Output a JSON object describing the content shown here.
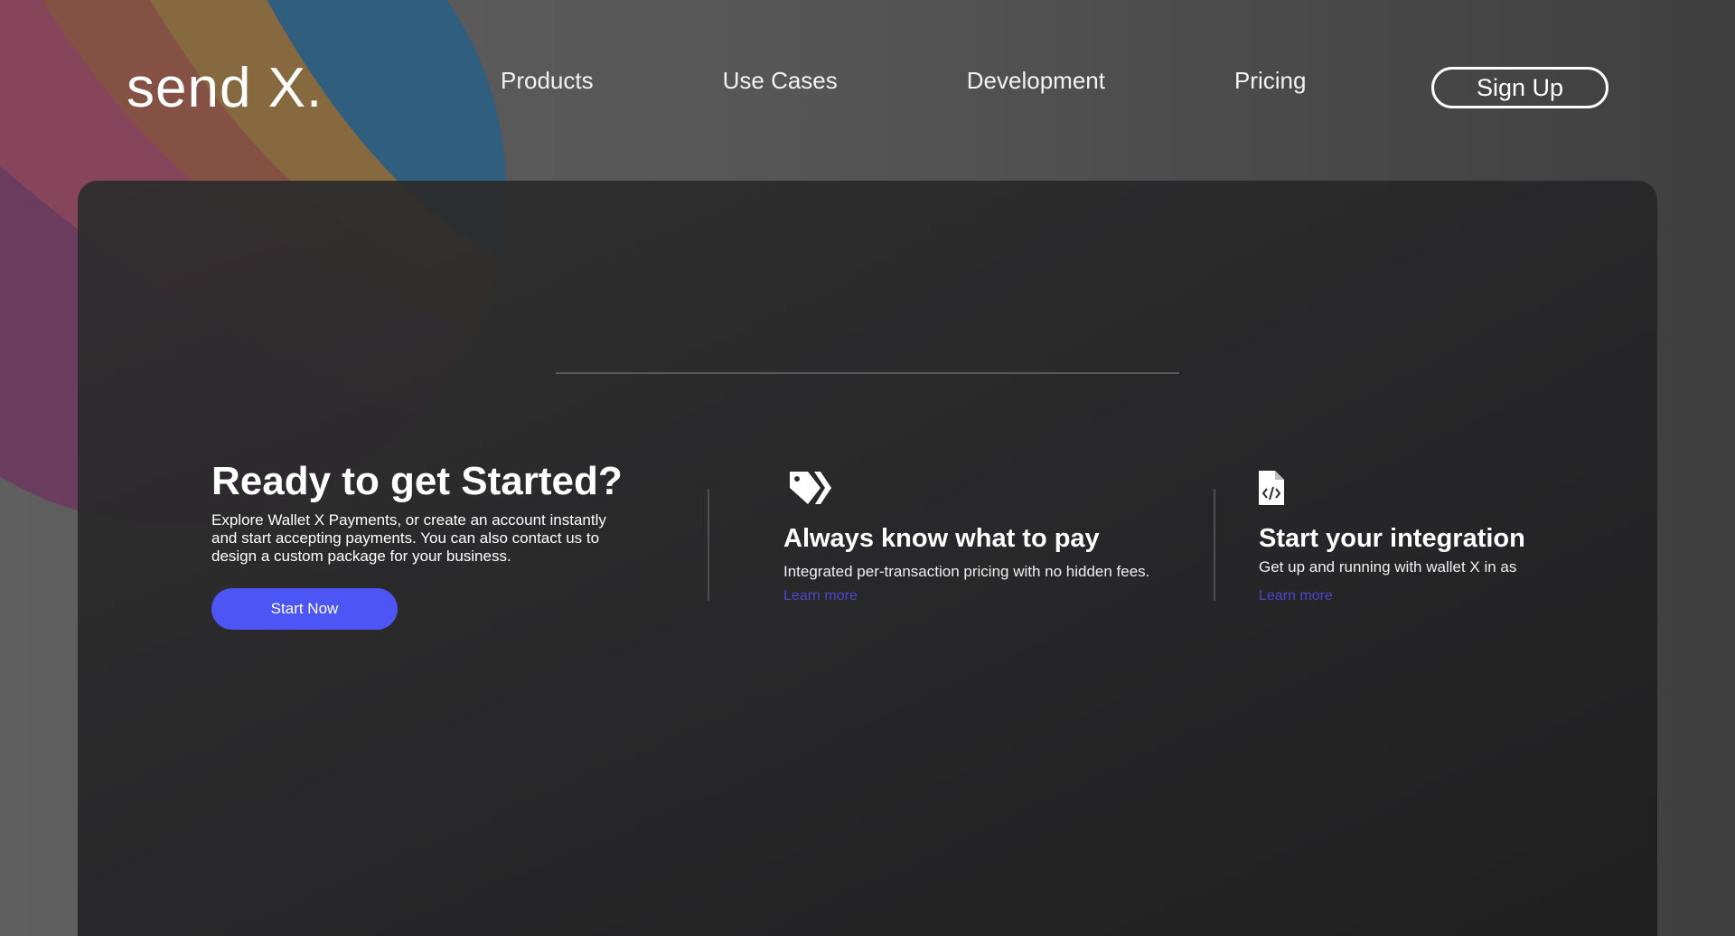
{
  "header": {
    "logo": "send X.",
    "nav": [
      "Products",
      "Use Cases",
      "Development",
      "Pricing"
    ],
    "signup_label": "Sign Up"
  },
  "cta": {
    "title": "Ready to get Started?",
    "text": "Explore Wallet X Payments, or create an account instantly and start accepting payments. You can also contact us to design a custom package for your business.",
    "button_label": "Start Now"
  },
  "features": [
    {
      "icon": "tags-icon",
      "title": "Always know what to pay",
      "text": "Integrated per-transaction pricing with no hidden fees.",
      "link": "Learn more"
    },
    {
      "icon": "code-file-icon",
      "title": "Start your integration",
      "text": "Get up and running with wallet X in as",
      "link": "Learn more"
    }
  ],
  "colors": {
    "accent": "#4d55f5",
    "link": "#4c45c9",
    "background": "#565656",
    "panel": "#2c2c2c"
  }
}
